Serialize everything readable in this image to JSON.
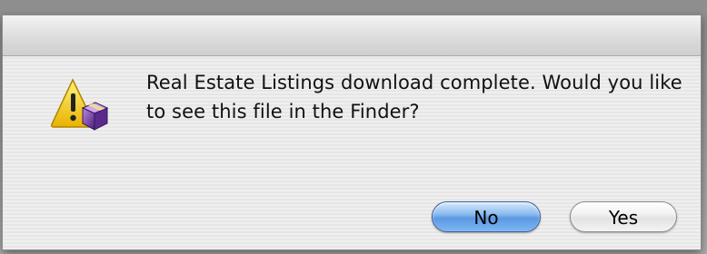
{
  "dialog": {
    "message": "Real Estate Listings download complete. Would you like to see this file in the Finder?",
    "icon": "caution-app-icon",
    "buttons": {
      "no_label": "No",
      "yes_label": "Yes",
      "default": "No"
    }
  },
  "colors": {
    "default_button": "#6aa5ea",
    "caution_yellow": "#f4c400",
    "package_purple": "#7a3fae"
  }
}
